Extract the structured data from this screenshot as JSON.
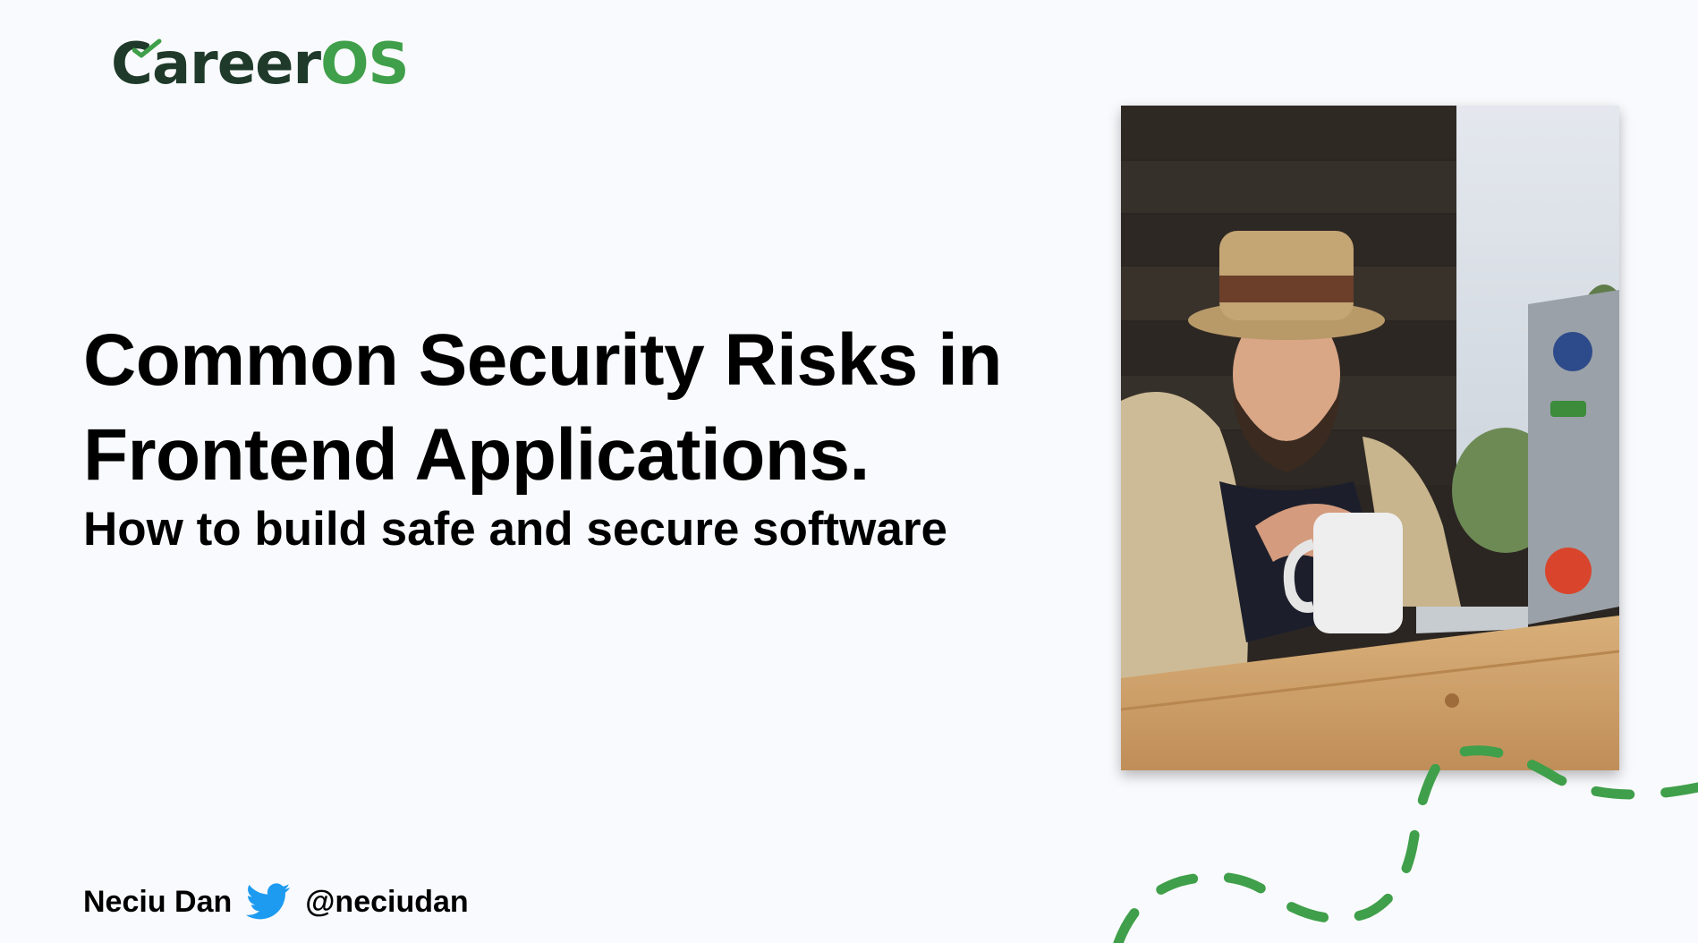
{
  "brand": {
    "name_part1": "Career",
    "name_part2": "OS",
    "colors": {
      "dark": "#1f3a2a",
      "green": "#3f9f4a"
    }
  },
  "slide": {
    "title_line1": "Common Security Risks in",
    "title_line2": "Frontend Applications.",
    "subtitle": "How to build safe and secure software"
  },
  "speaker": {
    "name": "Neciu Dan",
    "social_icon": "twitter-bird-icon",
    "handle": "@neciudan"
  },
  "accent_colors": {
    "twitter": "#1d9bf0",
    "dash": "#3f9f4a"
  }
}
